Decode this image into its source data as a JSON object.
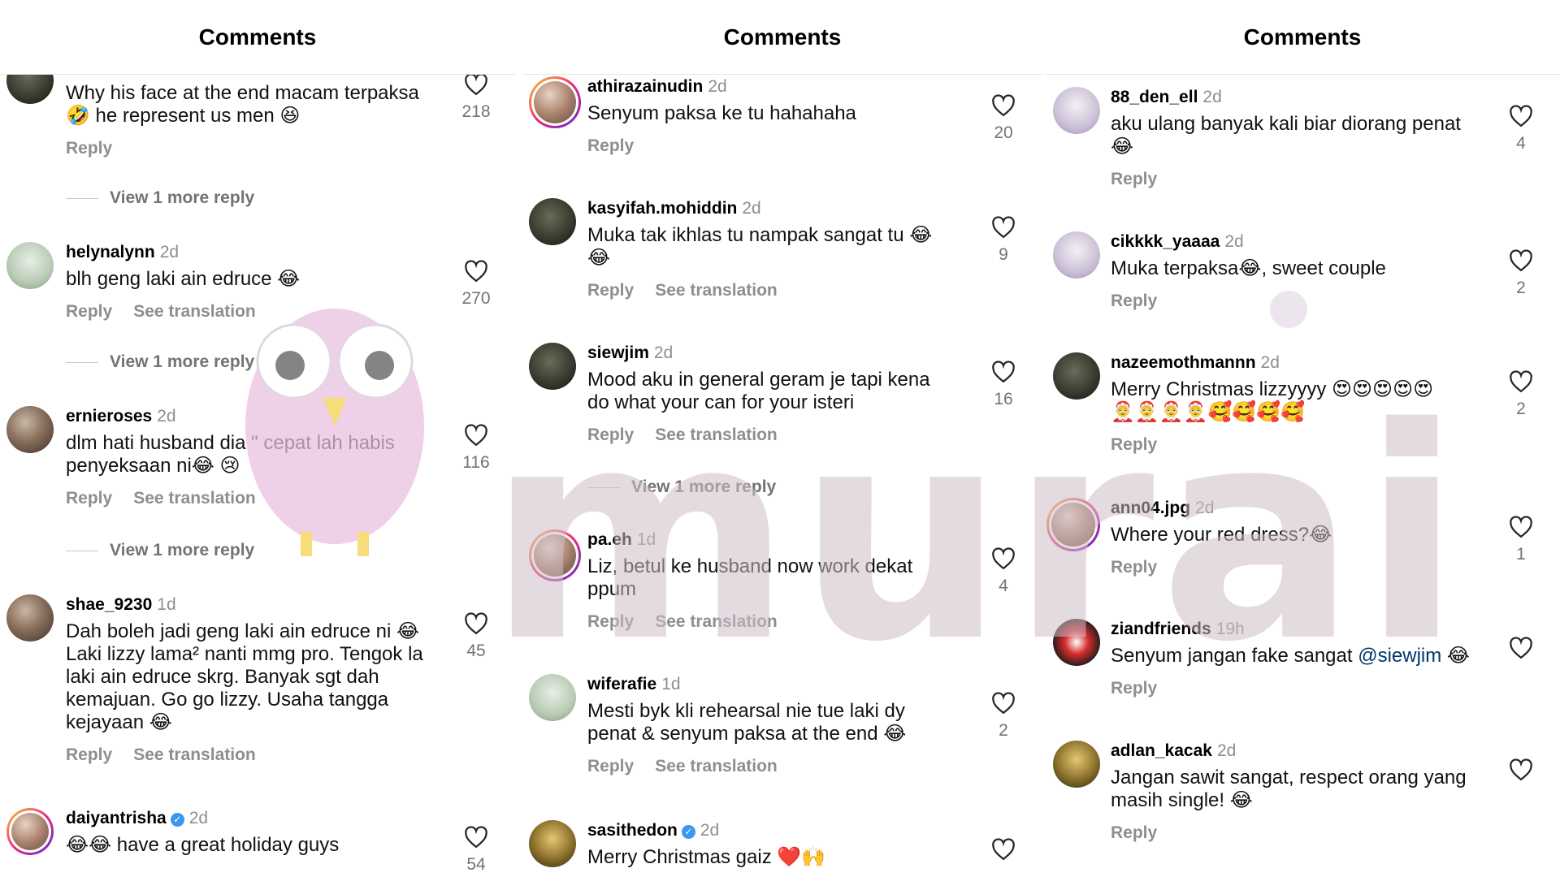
{
  "panels": [
    {
      "title": "Comments",
      "comments": [
        {
          "username": "",
          "time": "",
          "text": "Why his face at the end macam terpaksa\n🤣 he represent us men 😆",
          "reply": "Reply",
          "translate": "",
          "likes": "218"
        },
        {
          "username": "helynalynn",
          "time": "2d",
          "text": "blh geng laki ain edruce 😂",
          "reply": "Reply",
          "translate": "See translation",
          "likes": "270"
        },
        {
          "username": "ernieroses",
          "time": "2d",
          "text": "dlm hati husband dia \" cepat lah habis\npenyeksaan ni😂 😢",
          "reply": "Reply",
          "translate": "See translation",
          "likes": "116"
        },
        {
          "username": "shae_9230",
          "time": "1d",
          "text": "Dah boleh jadi geng laki ain edruce ni 😂\nLaki lizzy lama² nanti mmg pro. Tengok la\nlaki ain edruce skrg. Banyak sgt dah\nkemajuan. Go go lizzy. Usaha tangga\nkejayaan 😂",
          "reply": "Reply",
          "translate": "See translation",
          "likes": "45"
        },
        {
          "username": "daiyantrisha",
          "time": "2d",
          "text": "😂😂 have a great holiday guys",
          "reply": "",
          "translate": "",
          "likes": "54"
        }
      ],
      "more_replies": [
        "View 1 more reply",
        "View 1 more reply",
        "View 1 more reply"
      ]
    },
    {
      "title": "Comments",
      "comments": [
        {
          "username": "athirazainudin",
          "time": "2d",
          "text": "Senyum paksa ke tu hahahaha",
          "reply": "Reply",
          "translate": "",
          "likes": "20"
        },
        {
          "username": "kasyifah.mohiddin",
          "time": "2d",
          "text": "Muka tak ikhlas tu nampak sangat tu 😂\n😂",
          "reply": "Reply",
          "translate": "See translation",
          "likes": "9"
        },
        {
          "username": "siewjim",
          "time": "2d",
          "text": "Mood aku in general geram je tapi kena\ndo what your can for your isteri",
          "reply": "Reply",
          "translate": "See translation",
          "likes": "16"
        },
        {
          "username": "pa.eh",
          "time": "1d",
          "text": "Liz, betul ke husband now work dekat\nppum",
          "reply": "Reply",
          "translate": "See translation",
          "likes": "4"
        },
        {
          "username": "wiferafie",
          "time": "1d",
          "text": "Mesti byk kli rehearsal nie tue laki dy\npenat & senyum paksa at the end 😂",
          "reply": "Reply",
          "translate": "See translation",
          "likes": "2"
        },
        {
          "username": "sasithedon",
          "time": "2d",
          "text": "Merry Christmas gaiz ❤️🙌",
          "reply": "",
          "translate": "",
          "likes": ""
        }
      ],
      "more_replies": [
        "View 1 more reply"
      ]
    },
    {
      "title": "Comments",
      "comments": [
        {
          "username": "88_den_ell",
          "time": "2d",
          "text": "aku ulang banyak kali biar diorang penat\n😂",
          "reply": "Reply",
          "translate": "",
          "likes": "4"
        },
        {
          "username": "cikkkk_yaaaa",
          "time": "2d",
          "text": "Muka terpaksa😂, sweet couple",
          "reply": "Reply",
          "translate": "",
          "likes": "2"
        },
        {
          "username": "nazeemothmannn",
          "time": "2d",
          "text": "Merry Christmas lizzyyyy 😍😍😍😍😍\n🤶🤶🤶🤶🥰🥰🥰🥰",
          "reply": "Reply",
          "translate": "",
          "likes": "2"
        },
        {
          "username": "ann04.jpg",
          "time": "2d",
          "text": "Where your red dress?😂",
          "reply": "Reply",
          "translate": "",
          "likes": "1"
        },
        {
          "username": "ziandfriends",
          "time": "19h",
          "text_before": "Senyum jangan fake sangat ",
          "mention": "@siewjim",
          "text_after": " 😂",
          "reply": "Reply",
          "translate": "",
          "likes": ""
        },
        {
          "username": "adlan_kacak",
          "time": "2d",
          "text": "Jangan sawit sangat, respect orang yang\nmasih single! 😂",
          "reply": "Reply",
          "translate": "",
          "likes": ""
        }
      ]
    }
  ],
  "watermark": {
    "text": "murai",
    "color": "#cdbec8"
  },
  "icons": {
    "like": "heart-outline-icon",
    "verified": "verified-badge-icon"
  }
}
